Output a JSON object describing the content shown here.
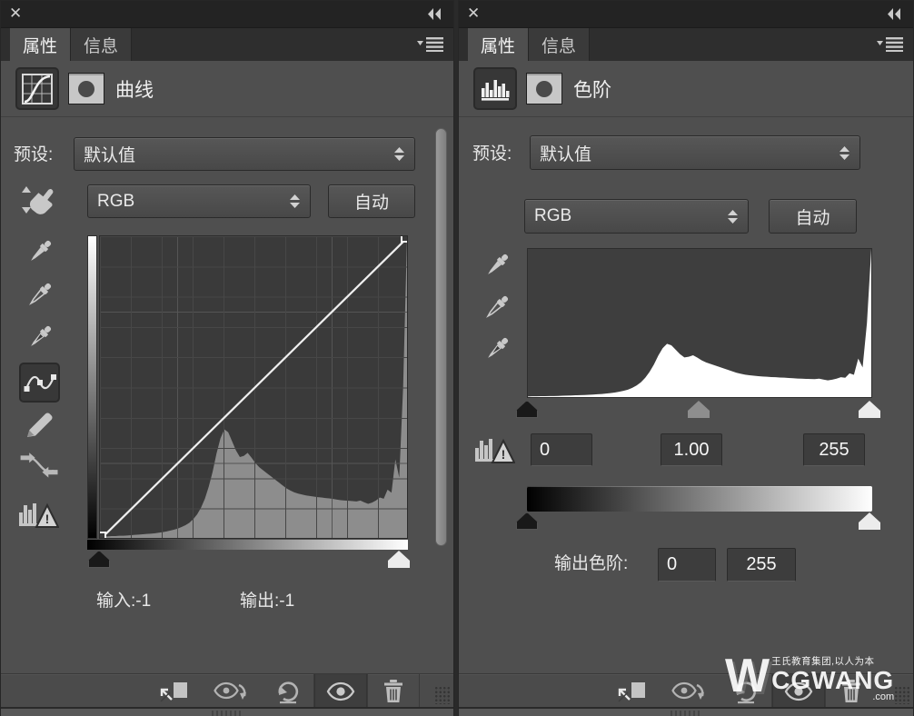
{
  "colors": {
    "panel_bg": "#4f4f4f",
    "titlebar_bg": "#232323",
    "grid_bg": "#3a3a3a",
    "curves_histogram": "#8d8d8d",
    "levels_histogram": "#ffffff",
    "icon_gray": "#c6c6c6"
  },
  "icons": {
    "close": "✕"
  },
  "histogram": {
    "values": [
      0.004,
      0.005,
      0.005,
      0.006,
      0.006,
      0.007,
      0.007,
      0.008,
      0.009,
      0.01,
      0.011,
      0.012,
      0.013,
      0.014,
      0.015,
      0.017,
      0.019,
      0.021,
      0.024,
      0.027,
      0.031,
      0.036,
      0.042,
      0.05,
      0.062,
      0.078,
      0.1,
      0.13,
      0.17,
      0.22,
      0.28,
      0.33,
      0.36,
      0.35,
      0.32,
      0.29,
      0.268,
      0.272,
      0.282,
      0.266,
      0.248,
      0.234,
      0.224,
      0.214,
      0.204,
      0.194,
      0.184,
      0.174,
      0.164,
      0.157,
      0.151,
      0.147,
      0.144,
      0.141,
      0.139,
      0.137,
      0.135,
      0.134,
      0.132,
      0.131,
      0.129,
      0.127,
      0.125,
      0.124,
      0.123,
      0.122,
      0.121,
      0.124,
      0.118,
      0.113,
      0.117,
      0.124,
      0.134,
      0.13,
      0.16,
      0.15,
      0.26,
      0.2,
      0.5,
      1.0
    ]
  },
  "panels": {
    "curves": {
      "tabs": [
        {
          "label": "属性"
        },
        {
          "label": "信息"
        }
      ],
      "title": "曲线",
      "preset_label": "预设:",
      "preset_value": "默认值",
      "channel_value": "RGB",
      "auto_label": "自动",
      "input_label": "输入:",
      "input_value": "-1",
      "output_label": "输出:",
      "output_value": "-1"
    },
    "levels": {
      "tabs": [
        {
          "label": "属性"
        },
        {
          "label": "信息"
        }
      ],
      "title": "色阶",
      "preset_label": "预设:",
      "preset_value": "默认值",
      "channel_value": "RGB",
      "auto_label": "自动",
      "shadow_input": "0",
      "midtone_input": "1.00",
      "highlight_input": "255",
      "output_label": "输出色阶:",
      "output_shadow": "0",
      "output_highlight": "255"
    }
  },
  "watermark": {
    "mark": "W",
    "tagline": "王氏教育集团,以人为本",
    "brand": "CGWANG",
    "suffix": ".com"
  }
}
